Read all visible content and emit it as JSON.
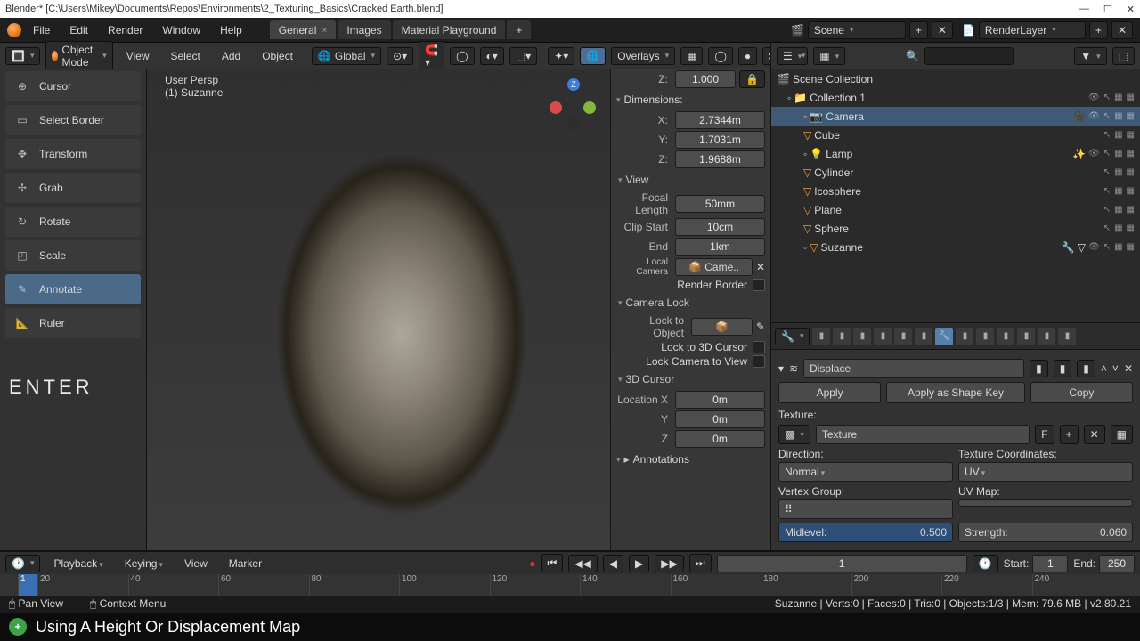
{
  "window": {
    "title": "Blender* [C:\\Users\\Mikey\\Documents\\Repos\\Environments\\2_Texturing_Basics\\Cracked Earth.blend]",
    "minimize": "—",
    "maximize": "☐",
    "close": "✕"
  },
  "topmenu": {
    "items": [
      "File",
      "Edit",
      "Render",
      "Window",
      "Help"
    ]
  },
  "workspaces": {
    "items": [
      {
        "label": "General",
        "active": true
      },
      {
        "label": "Images",
        "active": false
      },
      {
        "label": "Material Playground",
        "active": false
      }
    ],
    "add": "+"
  },
  "scenebox": {
    "scene": "Scene",
    "layer": "RenderLayer"
  },
  "toolshelf": {
    "items": [
      {
        "label": "Cursor",
        "icon": "cursor-icon"
      },
      {
        "label": "Select Border",
        "icon": "select-border-icon"
      },
      {
        "label": "Transform",
        "icon": "transform-icon"
      },
      {
        "label": "Grab",
        "icon": "grab-icon"
      },
      {
        "label": "Rotate",
        "icon": "rotate-icon"
      },
      {
        "label": "Scale",
        "icon": "scale-icon"
      },
      {
        "label": "Annotate",
        "icon": "annotate-icon",
        "active": true
      },
      {
        "label": "Ruler",
        "icon": "ruler-icon"
      }
    ],
    "overlay": "ENTER"
  },
  "view3d_header": {
    "mode": "Object Mode",
    "menus": [
      "View",
      "Select",
      "Add",
      "Object"
    ],
    "orientation": "Global",
    "overlays": "Overlays",
    "shading": "Shadi"
  },
  "view3d": {
    "line1": "User Persp",
    "line2": "(1) Suzanne"
  },
  "npanel": {
    "scale_z": {
      "label": "Z:",
      "value": "1.000"
    },
    "dimensions": {
      "title": "Dimensions:",
      "rows": [
        {
          "label": "X:",
          "value": "2.7344m"
        },
        {
          "label": "Y:",
          "value": "1.7031m"
        },
        {
          "label": "Z:",
          "value": "1.9688m"
        }
      ]
    },
    "view": {
      "title": "View",
      "focal": {
        "label": "Focal Length",
        "value": "50mm"
      },
      "clipstart": {
        "label": "Clip Start",
        "value": "10cm"
      },
      "clipend": {
        "label": "End",
        "value": "1km"
      },
      "localcam": {
        "label": "Local Camera",
        "value": "Came.."
      },
      "renderborder": "Render Border"
    },
    "camlock": {
      "title": "Camera Lock",
      "locktoobj": "Lock to Object",
      "lockto3d": "Lock to 3D Cursor",
      "locktoview": "Lock Camera to View"
    },
    "cursor3d": {
      "title": "3D Cursor",
      "rows": [
        {
          "label": "Location X",
          "value": "0m"
        },
        {
          "label": "Y",
          "value": "0m"
        },
        {
          "label": "Z",
          "value": "0m"
        }
      ]
    },
    "annotations": {
      "title": "Annotations"
    }
  },
  "outliner": {
    "search_placeholder": "",
    "root": "Scene Collection",
    "items": [
      {
        "name": "Collection 1",
        "indent": 1,
        "icon": "▸"
      },
      {
        "name": "Camera",
        "indent": 2,
        "sel": true
      },
      {
        "name": "Cube",
        "indent": 2
      },
      {
        "name": "Lamp",
        "indent": 2
      },
      {
        "name": "Cylinder",
        "indent": 2
      },
      {
        "name": "Icosphere",
        "indent": 2
      },
      {
        "name": "Plane",
        "indent": 2
      },
      {
        "name": "Sphere",
        "indent": 2
      },
      {
        "name": "Suzanne",
        "indent": 2
      }
    ]
  },
  "properties": {
    "modifier": "Displace",
    "apply": "Apply",
    "applyshape": "Apply as Shape Key",
    "copy": "Copy",
    "texture_lbl": "Texture:",
    "texture_val": "Texture",
    "fake": "F",
    "direction_lbl": "Direction:",
    "direction_val": "Normal",
    "texcoord_lbl": "Texture Coordinates:",
    "texcoord_val": "UV",
    "vgroup_lbl": "Vertex Group:",
    "uvmap_lbl": "UV Map:",
    "midlevel_lbl": "Midlevel:",
    "midlevel_val": "0.500",
    "strength_lbl": "Strength:",
    "strength_val": "0.060"
  },
  "timeline": {
    "menus": [
      "Playback",
      "Keying",
      "View",
      "Marker"
    ],
    "current": "1",
    "start_lbl": "Start:",
    "start_val": "1",
    "end_lbl": "End:",
    "end_val": "250",
    "ticks": [
      "1",
      "20",
      "40",
      "60",
      "80",
      "100",
      "120",
      "140",
      "160",
      "180",
      "200",
      "220",
      "240"
    ]
  },
  "status": {
    "left_items": [
      "Pan View",
      "Context Menu"
    ],
    "right": "Suzanne | Verts:0 | Faces:0 | Tris:0 | Objects:1/3 | Mem: 79.6 MB | v2.80.21"
  },
  "caption": "Using A Height Or Displacement Map"
}
